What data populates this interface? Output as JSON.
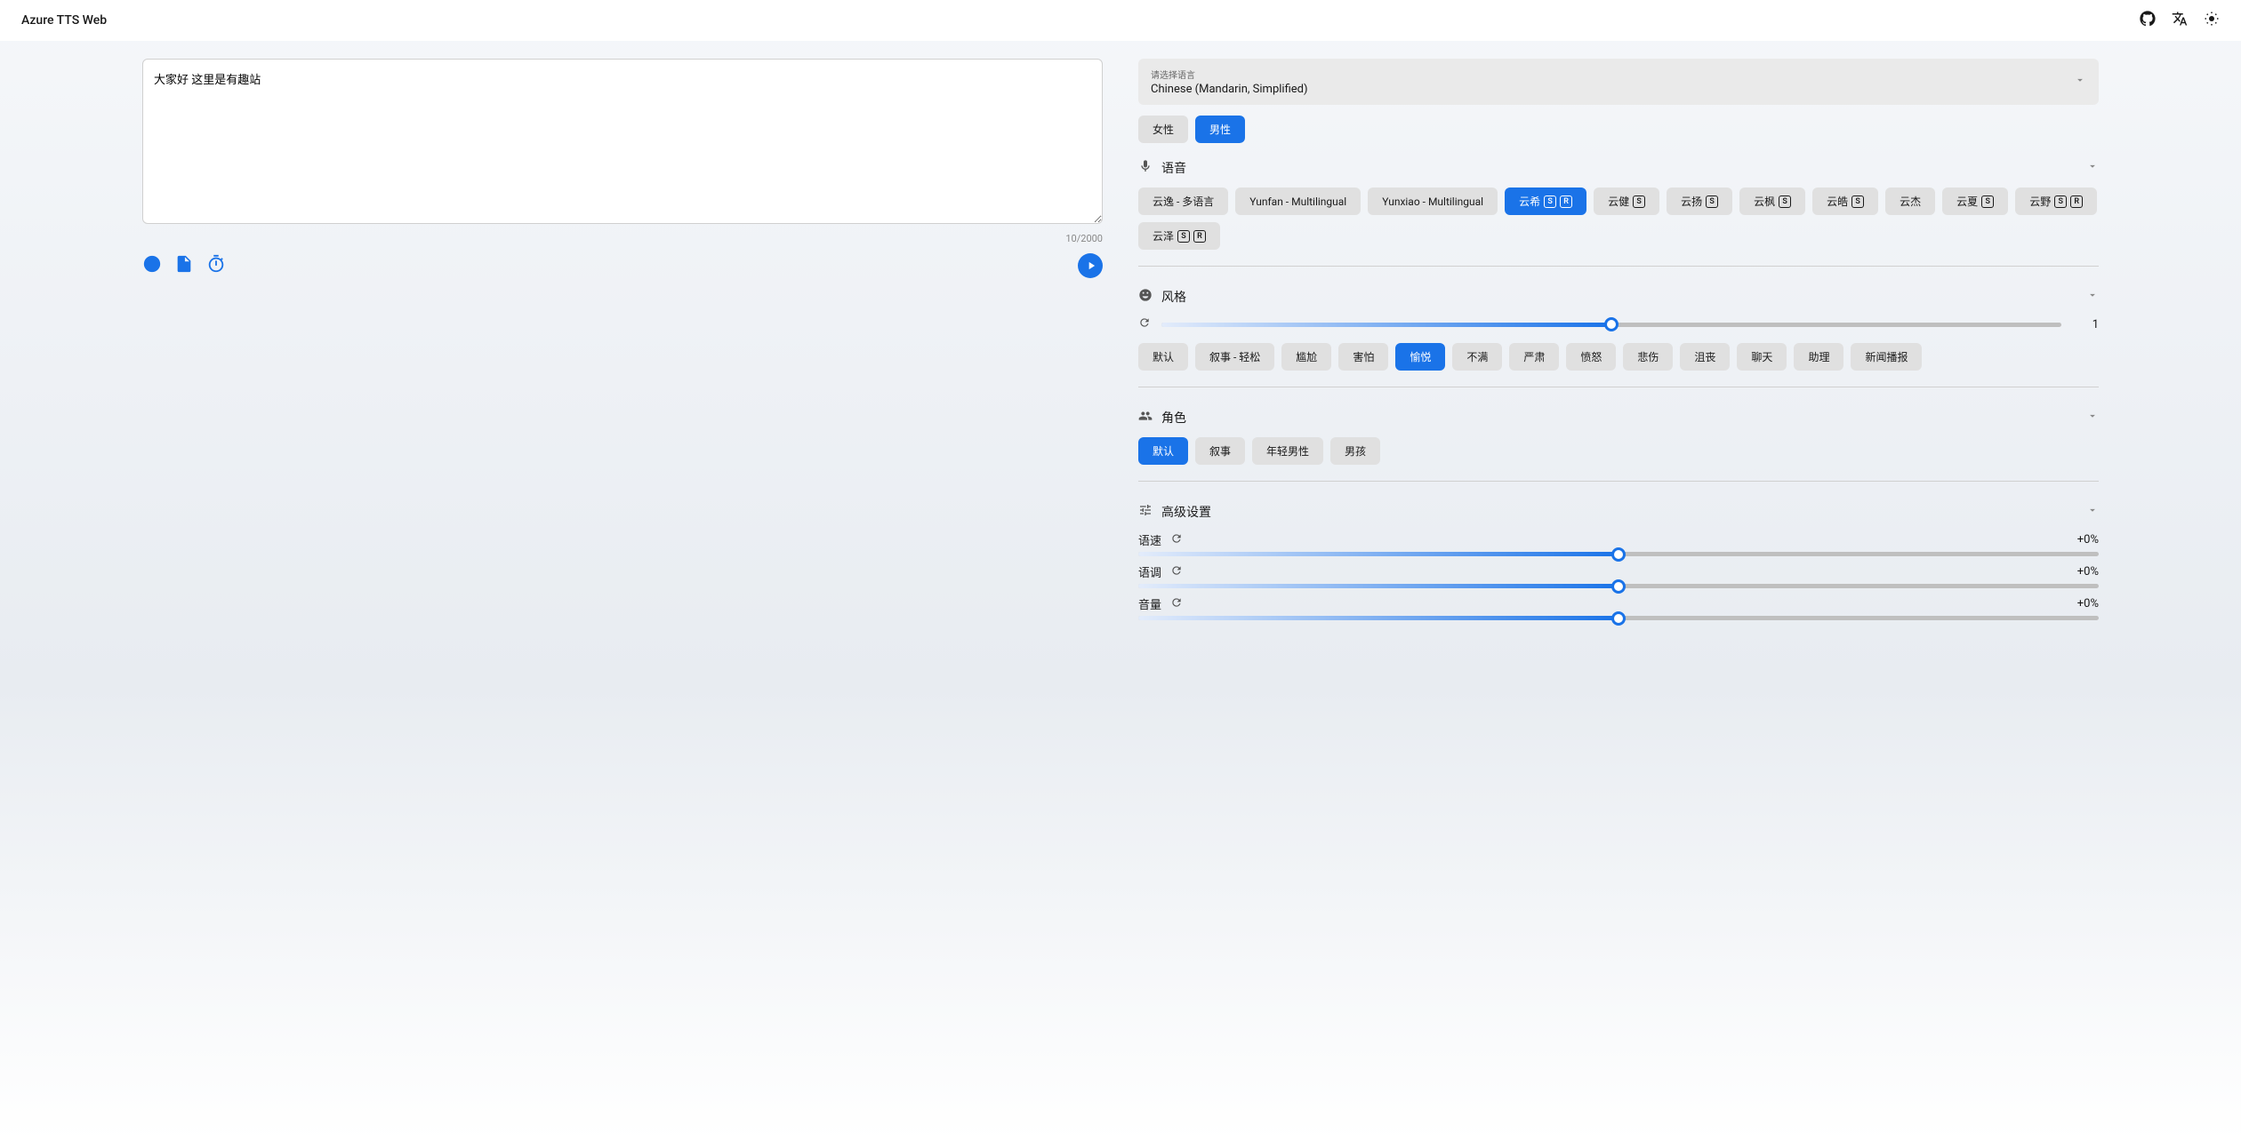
{
  "header": {
    "title": "Azure TTS Web"
  },
  "input": {
    "text": "大家好 这里是有趣站",
    "counter": "10/2000"
  },
  "language": {
    "label": "请选择语言",
    "value": "Chinese (Mandarin, Simplified)"
  },
  "gender": {
    "options": [
      "女性",
      "男性"
    ],
    "selected": 1
  },
  "sections": {
    "voice": "语音",
    "style": "风格",
    "role": "角色",
    "advanced": "高级设置"
  },
  "voices": [
    {
      "label": "云逸 - 多语言",
      "badges": []
    },
    {
      "label": "Yunfan - Multilingual",
      "badges": []
    },
    {
      "label": "Yunxiao - Multilingual",
      "badges": []
    },
    {
      "label": "云希",
      "badges": [
        "S",
        "R"
      ]
    },
    {
      "label": "云健",
      "badges": [
        "S"
      ]
    },
    {
      "label": "云扬",
      "badges": [
        "S"
      ]
    },
    {
      "label": "云枫",
      "badges": [
        "S"
      ]
    },
    {
      "label": "云皓",
      "badges": [
        "S"
      ]
    },
    {
      "label": "云杰",
      "badges": []
    },
    {
      "label": "云夏",
      "badges": [
        "S"
      ]
    },
    {
      "label": "云野",
      "badges": [
        "S",
        "R"
      ]
    },
    {
      "label": "云泽",
      "badges": [
        "S",
        "R"
      ]
    }
  ],
  "voice_selected": 3,
  "style": {
    "slider_value": "1",
    "slider_percent": 50,
    "options": [
      "默认",
      "叙事 - 轻松",
      "尴尬",
      "害怕",
      "愉悦",
      "不满",
      "严肃",
      "愤怒",
      "悲伤",
      "沮丧",
      "聊天",
      "助理",
      "新闻播报"
    ],
    "selected": 4
  },
  "role": {
    "options": [
      "默认",
      "叙事",
      "年轻男性",
      "男孩"
    ],
    "selected": 0
  },
  "advanced": {
    "rate": {
      "label": "语速",
      "value": "+0%",
      "percent": 50
    },
    "pitch": {
      "label": "语调",
      "value": "+0%",
      "percent": 50
    },
    "volume": {
      "label": "音量",
      "value": "+0%",
      "percent": 50
    }
  }
}
